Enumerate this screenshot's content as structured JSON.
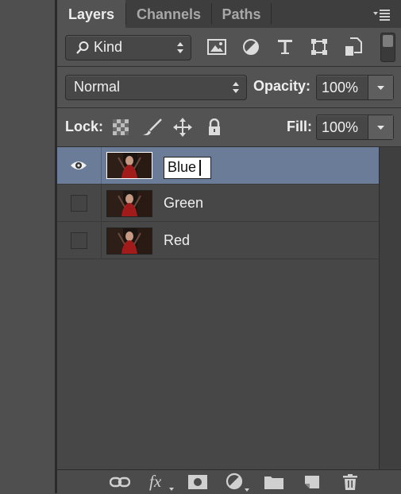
{
  "tabs": [
    {
      "label": "Layers",
      "active": true
    },
    {
      "label": "Channels",
      "active": false
    },
    {
      "label": "Paths",
      "active": false
    }
  ],
  "panel_menu_icon": "panel-menu-icon",
  "filter": {
    "kind_label": "Kind",
    "icons": [
      "image-filter-icon",
      "adjustment-filter-icon",
      "type-filter-icon",
      "shape-filter-icon",
      "smart-object-filter-icon"
    ]
  },
  "blend": {
    "mode": "Normal",
    "opacity_label": "Opacity:",
    "opacity_value": "100%"
  },
  "lock": {
    "label": "Lock:",
    "icons": [
      "lock-transparent-icon",
      "lock-image-icon",
      "lock-position-icon",
      "lock-all-icon"
    ],
    "fill_label": "Fill:",
    "fill_value": "100%"
  },
  "layers": [
    {
      "name": "Blue",
      "selected": true,
      "visible": true,
      "editing": true
    },
    {
      "name": "Green",
      "selected": false,
      "visible": false,
      "editing": false
    },
    {
      "name": "Red",
      "selected": false,
      "visible": false,
      "editing": false
    }
  ],
  "bottom_icons": [
    "link-layers-icon",
    "fx-icon",
    "mask-icon",
    "adjustment-layer-icon",
    "folder-icon",
    "new-layer-icon",
    "trash-icon"
  ],
  "colors": {
    "selected_row": "#6b7c99",
    "panel": "#535353",
    "list_bg": "#474747"
  }
}
